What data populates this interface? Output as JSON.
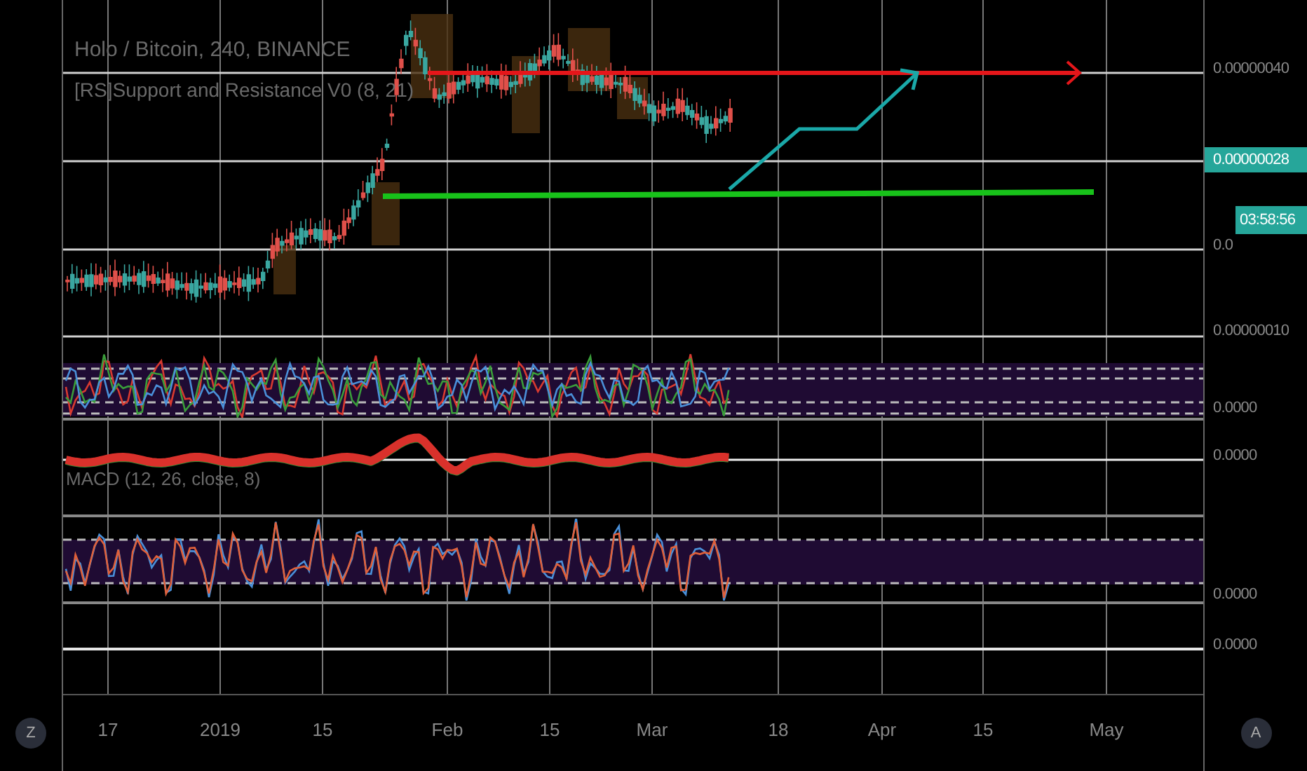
{
  "legend": {
    "symbol": "Holo / Bitcoin, 240, BINANCE",
    "indicator": "[RS]Support and Resistance V0 (8, 21)"
  },
  "price_axis": {
    "labels": [
      "0.00000040",
      "0.0",
      "0.00000010"
    ],
    "last_price": "0.00000028",
    "countdown": "03:58:56"
  },
  "panes": [
    {
      "kind": "stoch",
      "axis_label": "0.0000"
    },
    {
      "kind": "macd",
      "axis_label": "0.0000",
      "legend": "MACD (12, 26, close, 8)"
    },
    {
      "kind": "rsi",
      "axis_label": "0.0000"
    },
    {
      "kind": "empty",
      "axis_label": "0.0000"
    }
  ],
  "time_axis": [
    "17",
    "2019",
    "15",
    "Feb",
    "15",
    "Mar",
    "18",
    "Apr",
    "15",
    "May"
  ],
  "buttons": {
    "left": "Z",
    "right": "A"
  }
}
